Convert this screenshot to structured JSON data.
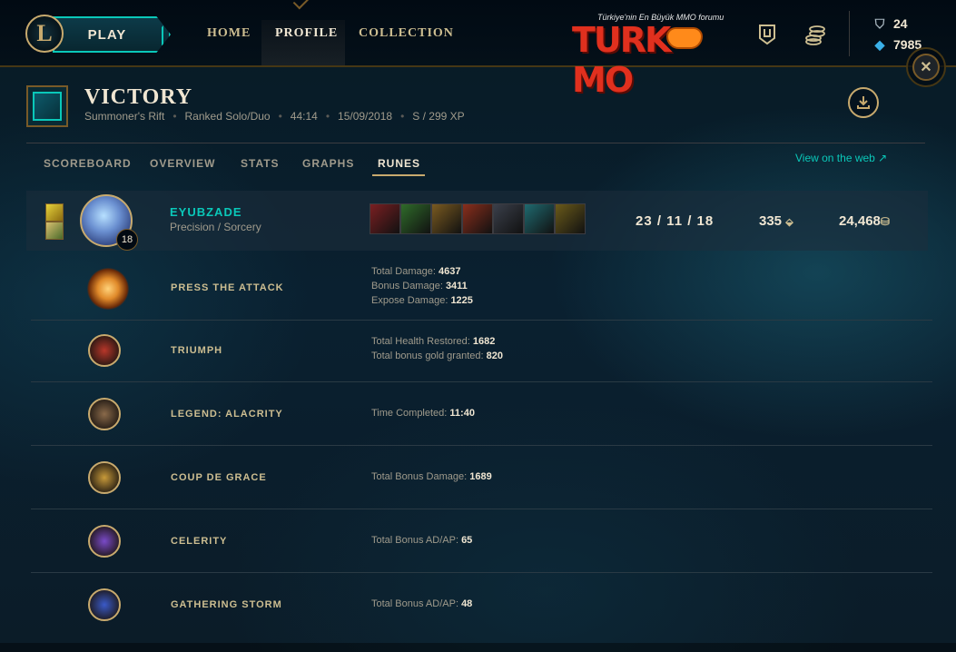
{
  "nav": {
    "play_label": "PLAY",
    "home_label": "HOME",
    "profile_label": "PROFILE",
    "collection_label": "COLLECTION",
    "watermark_tagline": "Türkiye'nin En Büyük MMO forumu",
    "watermark_word": "TURKMMO",
    "blue_essence": "24",
    "riot_points": "7985"
  },
  "header": {
    "title": "VICTORY",
    "map": "Summoner's Rift",
    "queue": "Ranked Solo/Duo",
    "duration": "44:14",
    "date": "15/09/2018",
    "grade": "S / 299 XP"
  },
  "tabs": [
    "SCOREBOARD",
    "OVERVIEW",
    "STATS",
    "GRAPHS",
    "RUNES"
  ],
  "view_web_label": "View on the web ↗",
  "player": {
    "name": "EYUBZADE",
    "rune_paths": "Precision / Sorcery",
    "level": "18",
    "kda": "23 / 11 / 18",
    "cs": "335",
    "gold": "24,468",
    "item_colors": [
      "#7a1f22",
      "#2f6b2a",
      "#7a5a20",
      "#8a2e1c",
      "#3a3f4a",
      "#1f6a70",
      "#6a5a1a"
    ]
  },
  "runes": [
    {
      "name": "PRESS THE ATTACK",
      "stats": [
        [
          "Total Damage:",
          "4637"
        ],
        [
          "Bonus Damage:",
          "3411"
        ],
        [
          "Expose Damage:",
          "1225"
        ]
      ],
      "color": "#e08a2a"
    },
    {
      "name": "TRIUMPH",
      "stats": [
        [
          "Total Health Restored:",
          "1682"
        ],
        [
          "Total bonus gold granted:",
          "820"
        ]
      ],
      "color": "#b8372a"
    },
    {
      "name": "LEGEND: ALACRITY",
      "stats": [
        [
          "Time Completed:",
          "11:40"
        ]
      ],
      "color": "#8a6a4a"
    },
    {
      "name": "COUP DE GRACE",
      "stats": [
        [
          "Total Bonus Damage:",
          "1689"
        ]
      ],
      "color": "#c89a3a"
    },
    {
      "name": "CELERITY",
      "stats": [
        [
          "Total Bonus AD/AP:",
          "65"
        ]
      ],
      "color": "#7a4ac8"
    },
    {
      "name": "GATHERING STORM",
      "stats": [
        [
          "Total Bonus AD/AP:",
          "48"
        ]
      ],
      "color": "#3a5ac8"
    }
  ]
}
